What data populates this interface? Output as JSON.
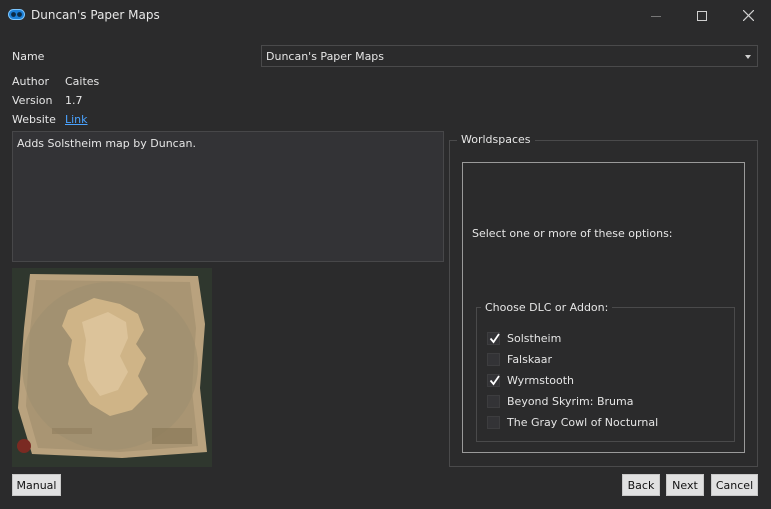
{
  "window": {
    "title": "Duncan's Paper Maps",
    "icon": "mod-organizer-icon",
    "controls": [
      "minimize-icon",
      "maximize-icon",
      "close-icon"
    ]
  },
  "info": {
    "name_label": "Name",
    "name_value": "Duncan's Paper Maps",
    "author_label": "Author",
    "author_value": "Caites",
    "version_label": "Version",
    "version_value": "1.7",
    "website_label": "Website",
    "website_link": "Link"
  },
  "description": "Adds Solstheim map by Duncan.",
  "worldspaces": {
    "title": "Worldspaces",
    "instructions": "Select one or more of these options:",
    "dlc_group_title": "Choose DLC or Addon:",
    "options": [
      {
        "label": "Solstheim",
        "checked": true
      },
      {
        "label": "Falskaar",
        "checked": false
      },
      {
        "label": "Wyrmstooth",
        "checked": true
      },
      {
        "label": "Beyond Skyrim: Bruma",
        "checked": false
      },
      {
        "label": "The Gray Cowl of Nocturnal",
        "checked": false
      }
    ]
  },
  "buttons": {
    "manual": "Manual",
    "back": "Back",
    "next": "Next",
    "cancel": "Cancel"
  },
  "colors": {
    "background": "#2b2b2c",
    "link": "#4aa3ff",
    "text": "#e6e6e6"
  }
}
